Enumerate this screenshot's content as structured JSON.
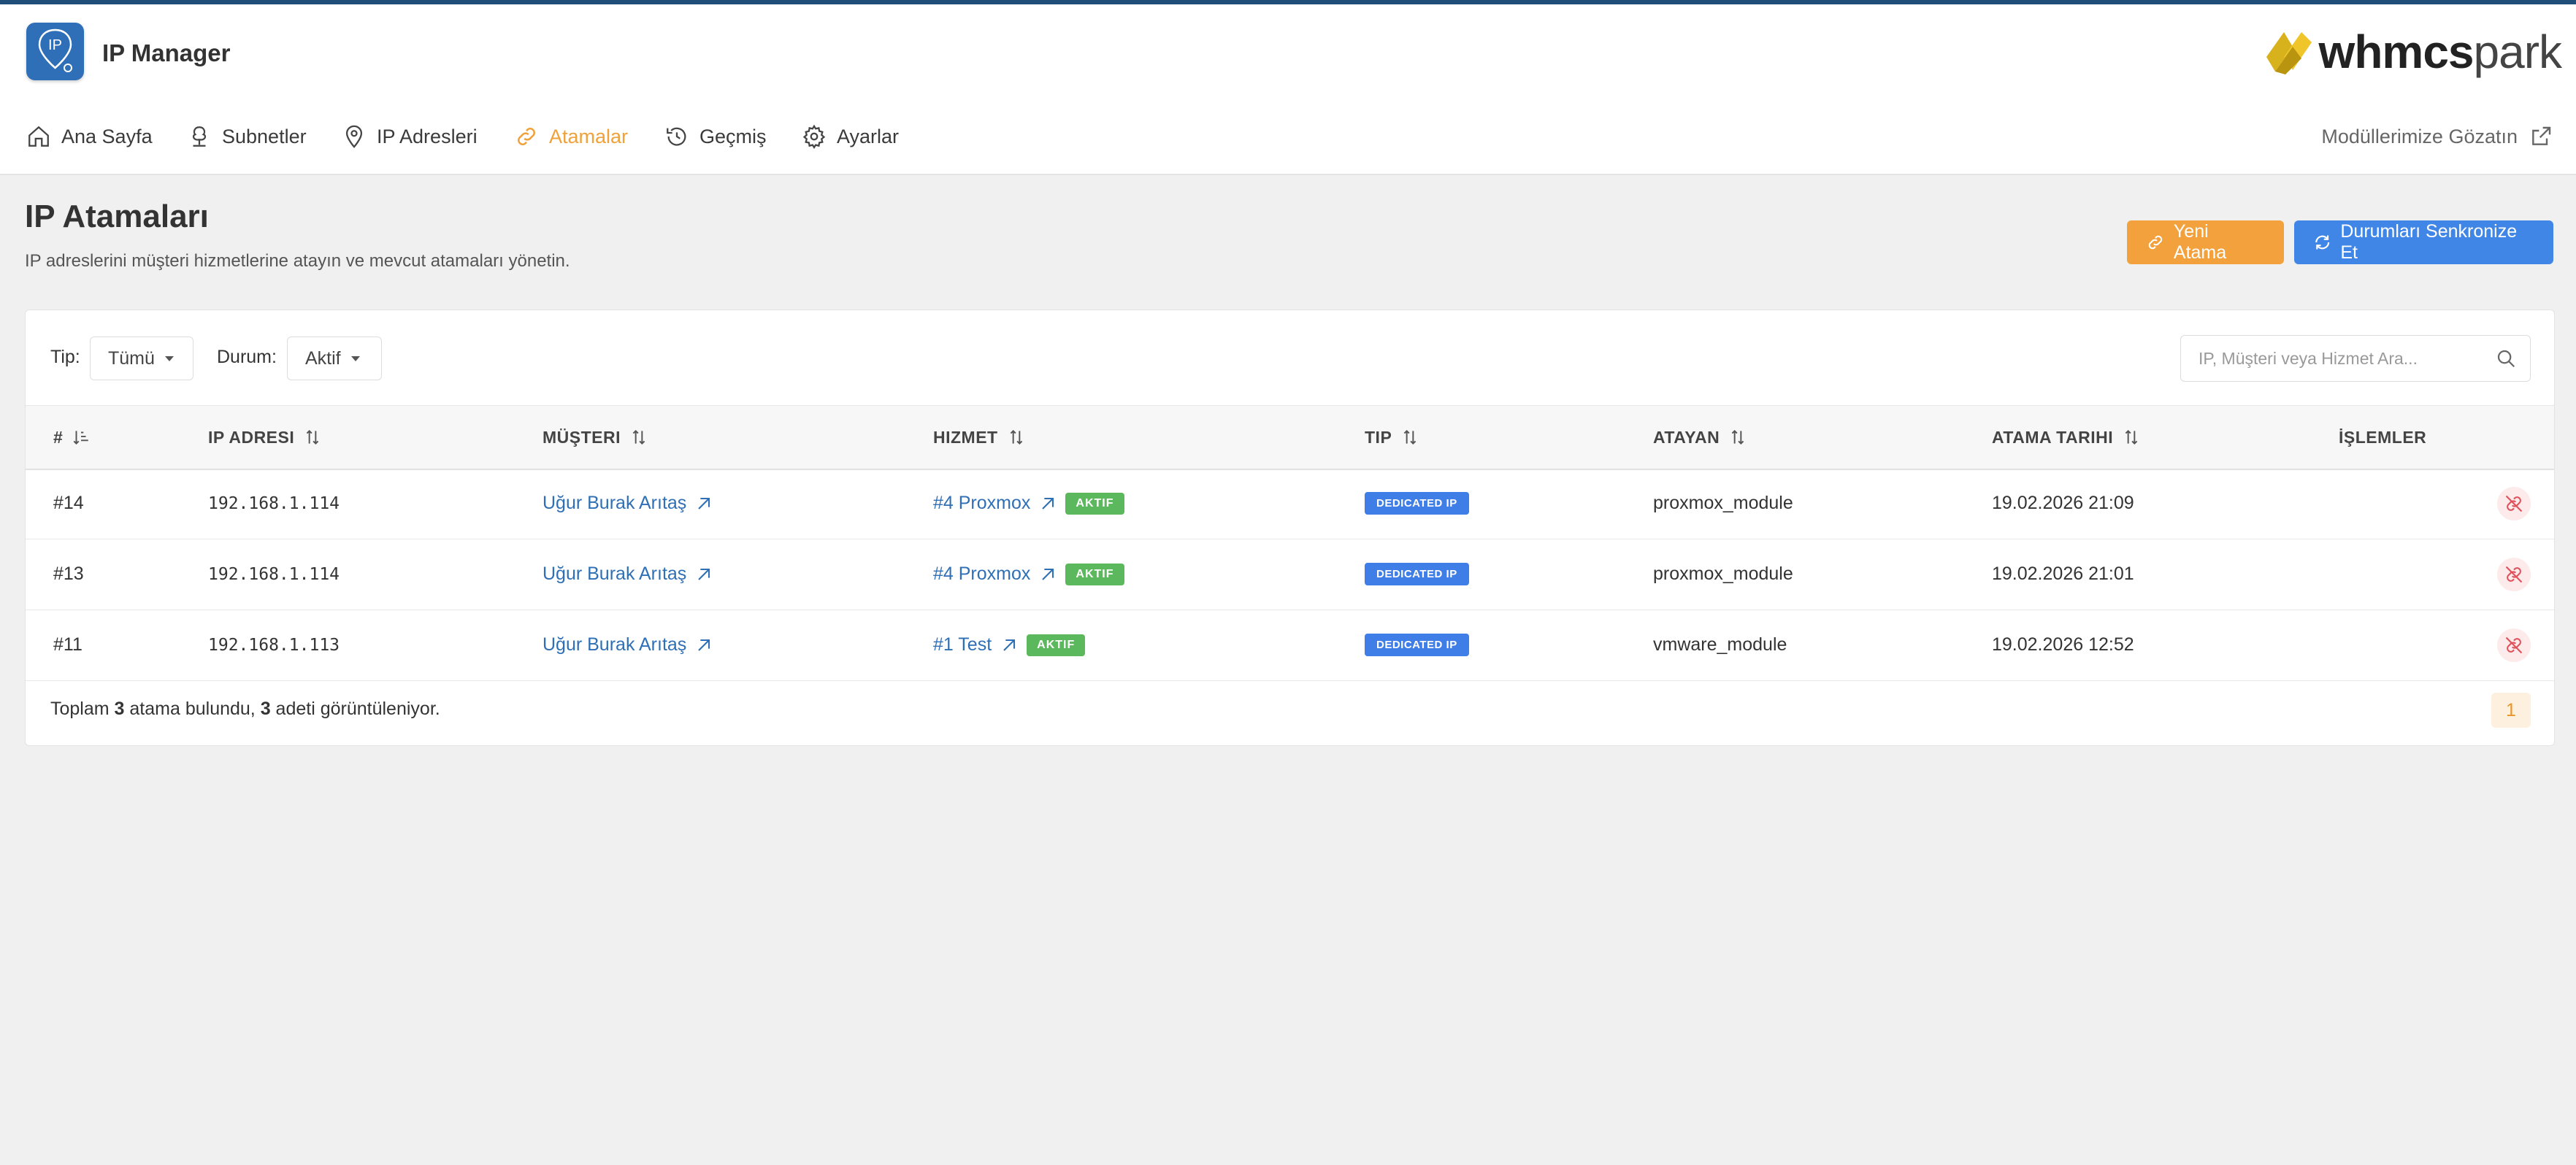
{
  "app": {
    "title": "IP Manager",
    "logo_text": "IP"
  },
  "brand": {
    "bold": "whmcs",
    "light": "park"
  },
  "nav": {
    "items": [
      {
        "label": "Ana Sayfa",
        "icon": "home-icon"
      },
      {
        "label": "Subnetler",
        "icon": "tree-icon"
      },
      {
        "label": "IP Adresleri",
        "icon": "map-pin-icon"
      },
      {
        "label": "Atamalar",
        "icon": "link-icon",
        "active": true
      },
      {
        "label": "Geçmiş",
        "icon": "history-icon"
      },
      {
        "label": "Ayarlar",
        "icon": "gear-icon"
      }
    ],
    "external_label": "Modüllerimize Gözatın"
  },
  "page": {
    "title": "IP Atamaları",
    "subtitle": "IP adreslerini müşteri hizmetlerine atayın ve mevcut atamaları yönetin.",
    "new_button": "Yeni Atama",
    "sync_button": "Durumları Senkronize Et"
  },
  "filters": {
    "type_label": "Tip:",
    "type_value": "Tümü",
    "status_label": "Durum:",
    "status_value": "Aktif",
    "search_placeholder": "IP, Müşteri veya Hizmet Ara..."
  },
  "table": {
    "headers": [
      "#",
      "IP ADRESI",
      "MÜŞTERI",
      "HIZMET",
      "TIP",
      "ATAYAN",
      "ATAMA TARIHI",
      "İŞLEMLER"
    ],
    "rows": [
      {
        "id": "#14",
        "ip": "192.168.1.114",
        "customer": "Uğur Burak Arıtaş",
        "service": "#4 Proxmox",
        "service_status": "AKTIF",
        "type": "DEDICATED IP",
        "assigner": "proxmox_module",
        "date": "19.02.2026 21:09"
      },
      {
        "id": "#13",
        "ip": "192.168.1.114",
        "customer": "Uğur Burak Arıtaş",
        "service": "#4 Proxmox",
        "service_status": "AKTIF",
        "type": "DEDICATED IP",
        "assigner": "proxmox_module",
        "date": "19.02.2026 21:01"
      },
      {
        "id": "#11",
        "ip": "192.168.1.113",
        "customer": "Uğur Burak Arıtaş",
        "service": "#1 Test",
        "service_status": "AKTIF",
        "type": "DEDICATED IP",
        "assigner": "vmware_module",
        "date": "19.02.2026 12:52"
      }
    ]
  },
  "footer": {
    "pre": "Toplam ",
    "total": "3",
    "mid": " atama bulundu, ",
    "shown": "3",
    "post": " adeti görüntüleniyor.",
    "page": "1"
  },
  "colors": {
    "accent_orange": "#f2a13c",
    "primary_blue": "#3f86e6",
    "badge_green": "#5cb85c",
    "link_blue": "#2f6fb5",
    "header_bar": "#1f4e79"
  }
}
